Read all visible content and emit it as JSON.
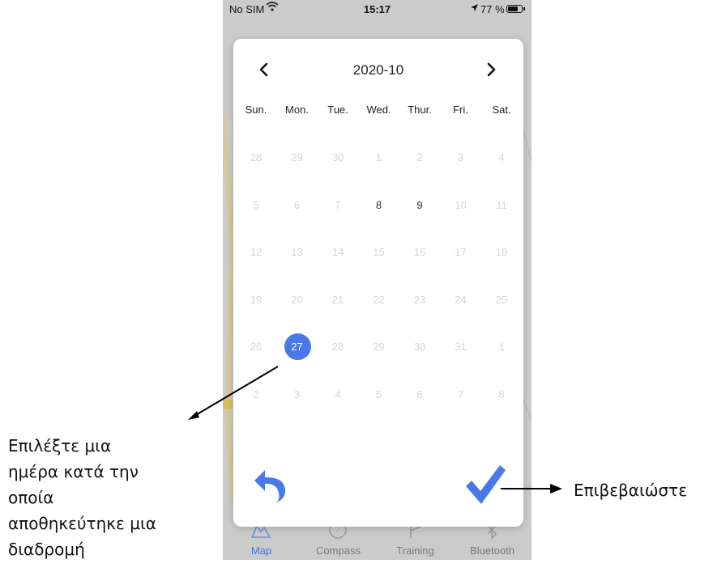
{
  "status_bar": {
    "carrier": "No SIM",
    "time": "15:17",
    "battery": "77 %"
  },
  "calendar": {
    "month_title": "2020-10",
    "weekdays": [
      "Sun.",
      "Mon.",
      "Tue.",
      "Wed.",
      "Thur.",
      "Fri.",
      "Sat."
    ],
    "weeks": [
      [
        "28",
        "29",
        "30",
        "1",
        "2",
        "3",
        "4"
      ],
      [
        "5",
        "6",
        "7",
        "8",
        "9",
        "10",
        "11"
      ],
      [
        "12",
        "13",
        "14",
        "15",
        "16",
        "17",
        "18"
      ],
      [
        "19",
        "20",
        "21",
        "22",
        "23",
        "24",
        "25"
      ],
      [
        "26",
        "27",
        "28",
        "29",
        "30",
        "31",
        "1"
      ],
      [
        "2",
        "3",
        "4",
        "5",
        "6",
        "7",
        "8"
      ]
    ],
    "days_with_routes": [
      "8",
      "9"
    ],
    "selected_day": "27",
    "accent_color": "#4a78e8"
  },
  "tabs": [
    {
      "label": "Map",
      "icon": "map-icon",
      "active": true
    },
    {
      "label": "Compass",
      "icon": "compass-icon",
      "active": false
    },
    {
      "label": "Training",
      "icon": "flag-icon",
      "active": false
    },
    {
      "label": "Bluetooth",
      "icon": "bluetooth-icon",
      "active": false
    }
  ],
  "annotations": {
    "select_day": "Επιλέξτε μια ημέρα κατά την οποία αποθηκεύτηκε μια διαδρομή",
    "select_day_lines": [
      "Επιλέξτε μια",
      "ημέρα κατά την",
      "οποία",
      "αποθηκεύτηκε μια",
      "διαδρομή"
    ],
    "confirm": "Επιβεβαιώστε"
  }
}
